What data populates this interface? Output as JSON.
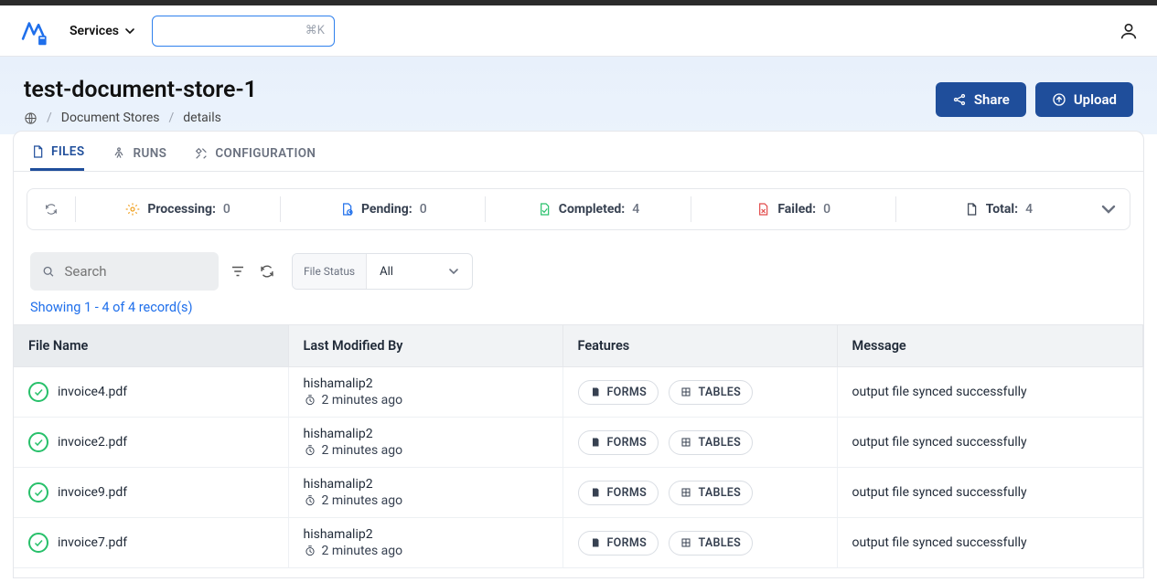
{
  "nav": {
    "services": "Services",
    "cmd_shortcut": "⌘K"
  },
  "hero": {
    "title": "test-document-store-1",
    "breadcrumb": {
      "home_icon": "globe",
      "docstores": "Document Stores",
      "details": "details"
    },
    "share": "Share",
    "upload": "Upload"
  },
  "tabs": {
    "files": "FILES",
    "runs": "RUNS",
    "config": "CONFIGURATION"
  },
  "stats": {
    "processing": {
      "label": "Processing:",
      "value": "0"
    },
    "pending": {
      "label": "Pending:",
      "value": "0"
    },
    "completed": {
      "label": "Completed:",
      "value": "4"
    },
    "failed": {
      "label": "Failed:",
      "value": "0"
    },
    "total": {
      "label": "Total:",
      "value": "4"
    }
  },
  "toolbar": {
    "search_placeholder": "Search",
    "filter_label": "File Status",
    "filter_value": "All"
  },
  "showing": "Showing 1 - 4 of 4 record(s)",
  "columns": {
    "c1": "File Name",
    "c2": "Last Modified By",
    "c3": "Features",
    "c4": "Message"
  },
  "chips": {
    "forms": "FORMS",
    "tables": "TABLES"
  },
  "rows": [
    {
      "file": "invoice4.pdf",
      "user": "hishamalip2",
      "when": "2 minutes ago",
      "msg": "output file synced successfully"
    },
    {
      "file": "invoice2.pdf",
      "user": "hishamalip2",
      "when": "2 minutes ago",
      "msg": "output file synced successfully"
    },
    {
      "file": "invoice9.pdf",
      "user": "hishamalip2",
      "when": "2 minutes ago",
      "msg": "output file synced successfully"
    },
    {
      "file": "invoice7.pdf",
      "user": "hishamalip2",
      "when": "2 minutes ago",
      "msg": "output file synced successfully"
    }
  ]
}
